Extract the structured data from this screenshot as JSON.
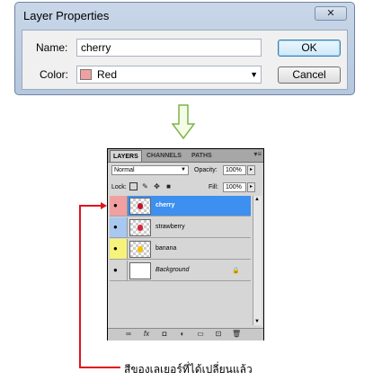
{
  "dialog": {
    "title": "Layer Properties",
    "close_icon": "close-icon",
    "name_label": "Name:",
    "name_value": "cherry",
    "color_label": "Color:",
    "color_value": "Red",
    "color_swatch": "#f0a0a0",
    "ok_label": "OK",
    "cancel_label": "Cancel"
  },
  "panel": {
    "tabs": [
      "LAYERS",
      "CHANNELS",
      "PATHS"
    ],
    "blend_mode": "Normal",
    "opacity_label": "Opacity:",
    "opacity_value": "100%",
    "lock_label": "Lock:",
    "fill_label": "Fill:",
    "fill_value": "100%",
    "layers": [
      {
        "name": "cherry",
        "color": "#f0a0a0",
        "selected": true
      },
      {
        "name": "strawberry",
        "color": "#a8c8f0",
        "selected": false
      },
      {
        "name": "banana",
        "color": "#f7f37a",
        "selected": false
      },
      {
        "name": "Background",
        "color": "#d6d6d6",
        "selected": false
      }
    ],
    "bottom_icons": [
      "link-icon",
      "fx-icon",
      "mask-icon",
      "adjustment-icon",
      "group-icon",
      "new-layer-icon",
      "trash-icon"
    ],
    "bottom_glyphs": [
      "∞",
      "fx",
      "◘",
      "◐",
      "▭",
      "⊡",
      "🗑"
    ]
  },
  "caption": "สีของเลเยอร์ที่ได้เปลี่ยนแล้ว",
  "colors": {
    "accent_red": "#e0141e",
    "selection_blue": "#3d8ff0"
  }
}
